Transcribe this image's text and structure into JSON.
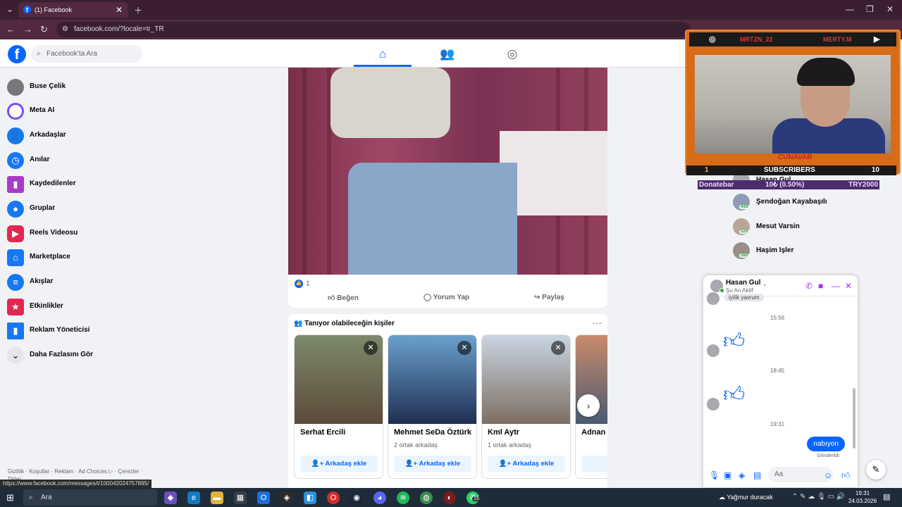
{
  "browser": {
    "tab_title": "(1) Facebook",
    "url": "facebook.com/?locale=tr_TR",
    "status_url": "https://www.facebook.com/messages/t/100042024757895/"
  },
  "header": {
    "search_placeholder": "Facebook'ta Ara"
  },
  "sidebar": {
    "items": [
      {
        "label": "Buse Çelik",
        "icon": "avatar"
      },
      {
        "label": "Meta AI",
        "icon": "meta-ai-icon"
      },
      {
        "label": "Arkadaşlar",
        "icon": "friends-icon"
      },
      {
        "label": "Anılar",
        "icon": "memories-icon"
      },
      {
        "label": "Kaydedilenler",
        "icon": "saved-icon"
      },
      {
        "label": "Gruplar",
        "icon": "groups-icon"
      },
      {
        "label": "Reels Videosu",
        "icon": "reels-icon"
      },
      {
        "label": "Marketplace",
        "icon": "marketplace-icon"
      },
      {
        "label": "Akışlar",
        "icon": "feeds-icon"
      },
      {
        "label": "Etkinlikler",
        "icon": "events-icon"
      },
      {
        "label": "Reklam Yöneticisi",
        "icon": "ads-manager-icon"
      },
      {
        "label": "Daha Fazlasını Gör",
        "icon": "chevron-down-icon"
      }
    ],
    "footer": "Gizlilik · Koşullar · Reklam · Ad Choices ▷ · Çerezler · Diğer"
  },
  "post": {
    "like_count": "1",
    "actions": {
      "like": "Beğen",
      "comment": "Yorum Yap",
      "share": "Paylaş"
    }
  },
  "people": {
    "title": "Tanıyor olabileceğin kişiler",
    "cards": [
      {
        "name": "Serhat Ercili",
        "mutual": "",
        "add": "Arkadaş ekle"
      },
      {
        "name": "Mehmet SeDa Öztürk",
        "mutual": "2 ortak arkadaş",
        "add": "Arkadaş ekle"
      },
      {
        "name": "Kml Aytr",
        "mutual": "1 ortak arkadaş",
        "add": "Arkadaş ekle"
      },
      {
        "name": "Adnan",
        "mutual": "",
        "add": "A"
      }
    ]
  },
  "contacts": [
    {
      "name": "Hasan Gul",
      "badge": ""
    },
    {
      "name": "Şendoğan Kayabaşılı",
      "badge": "44d"
    },
    {
      "name": "Mesut Varsin",
      "badge": "52d"
    },
    {
      "name": "Haşim Işler",
      "badge": "38d"
    }
  ],
  "overlay": {
    "user1": "MRTZN_22",
    "user2": "MERTY.M",
    "name_tag": "CUNAVAR",
    "subs_left": "1",
    "subs_label": "SUBSCRIBERS",
    "subs_right": "10",
    "donate_label": "Donatebar",
    "donate_amount": "10₺ (0.50%)",
    "donate_goal": "TRY2000"
  },
  "chat": {
    "name": "Hasan Gul",
    "status": "Şu An Aktif",
    "prev_msg": "iyilik yavrum",
    "times": [
      "15:56",
      "18:45",
      "19:31"
    ],
    "last_msg": "nabıyon",
    "sent_label": "Gönderildi",
    "input_placeholder": "Aa"
  },
  "taskbar": {
    "search": "Ara",
    "weather": "Yağmur duracak",
    "time": "19:31",
    "date": "24.03.2026",
    "whatsapp_badge": "15"
  }
}
